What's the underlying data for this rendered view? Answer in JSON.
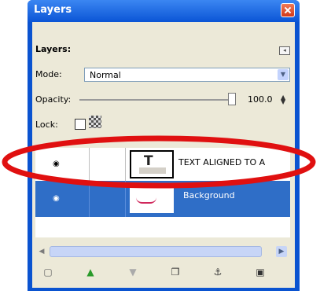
{
  "window": {
    "title": "Layers"
  },
  "panel": {
    "header_label": "Layers:",
    "mode_label": "Mode:",
    "mode_value": "Normal",
    "opacity_label": "Opacity:",
    "opacity_value": "100.0",
    "lock_label": "Lock:"
  },
  "layers": [
    {
      "name": "TEXT ALIGNED TO A",
      "selected": false,
      "visible_icon": "eye-icon"
    },
    {
      "name": "Background",
      "selected": true,
      "visible_icon": "eye-icon"
    }
  ],
  "toolbar": {
    "buttons": [
      "new-layer",
      "raise-layer",
      "lower-layer",
      "duplicate-layer",
      "anchor-layer",
      "delete-layer"
    ]
  },
  "colors": {
    "titlebar": "#0b55d6",
    "selected_row": "#2f6ec7",
    "highlight_ellipse": "#e01010"
  }
}
